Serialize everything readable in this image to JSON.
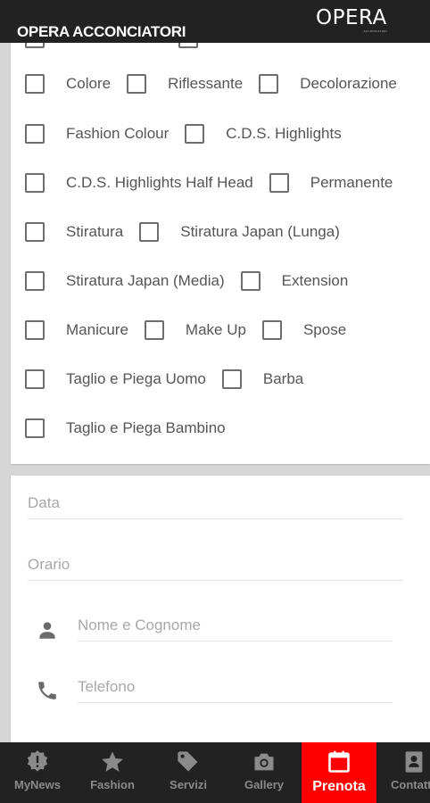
{
  "header": {
    "title": "OPERA ACCONCIATORI",
    "brand_logo": "OPERA",
    "brand_sub": "ACCONCIATORI"
  },
  "services": {
    "items": [
      {
        "label": "Colore",
        "checked": false
      },
      {
        "label": "Riflessante",
        "checked": false
      },
      {
        "label": "Decolorazione",
        "checked": false
      },
      {
        "label": "Fashion Colour",
        "checked": false
      },
      {
        "label": "C.D.S. Highlights",
        "checked": false
      },
      {
        "label": "C.D.S. Highlights Half Head",
        "checked": false
      },
      {
        "label": "Permanente",
        "checked": false
      },
      {
        "label": "Stiratura",
        "checked": false
      },
      {
        "label": "Stiratura Japan (Lunga)",
        "checked": false
      },
      {
        "label": "Stiratura Japan (Media)",
        "checked": false
      },
      {
        "label": "Extension",
        "checked": false
      },
      {
        "label": "Manicure",
        "checked": false
      },
      {
        "label": "Make Up",
        "checked": false
      },
      {
        "label": "Spose",
        "checked": false
      },
      {
        "label": "Taglio e Piega Uomo",
        "checked": false
      },
      {
        "label": "Barba",
        "checked": false
      },
      {
        "label": "Taglio e Piega Bambino",
        "checked": false
      }
    ]
  },
  "form": {
    "date_placeholder": "Data",
    "time_placeholder": "Orario",
    "name_placeholder": "Nome e Cognome",
    "phone_placeholder": "Telefono"
  },
  "nav": {
    "items": [
      {
        "label": "MyNews",
        "icon": "badge-icon"
      },
      {
        "label": "Fashion",
        "icon": "star-icon"
      },
      {
        "label": "Servizi",
        "icon": "tag-icon"
      },
      {
        "label": "Gallery",
        "icon": "camera-icon"
      },
      {
        "label": "Prenota",
        "icon": "calendar-icon",
        "active": true
      },
      {
        "label": "Contatti",
        "icon": "contacts-icon"
      }
    ]
  },
  "colors": {
    "header_bg": "#222222",
    "accent": "#ff0000",
    "nav_label": "#8a8a8a",
    "page_bg": "#d6d6d6"
  }
}
